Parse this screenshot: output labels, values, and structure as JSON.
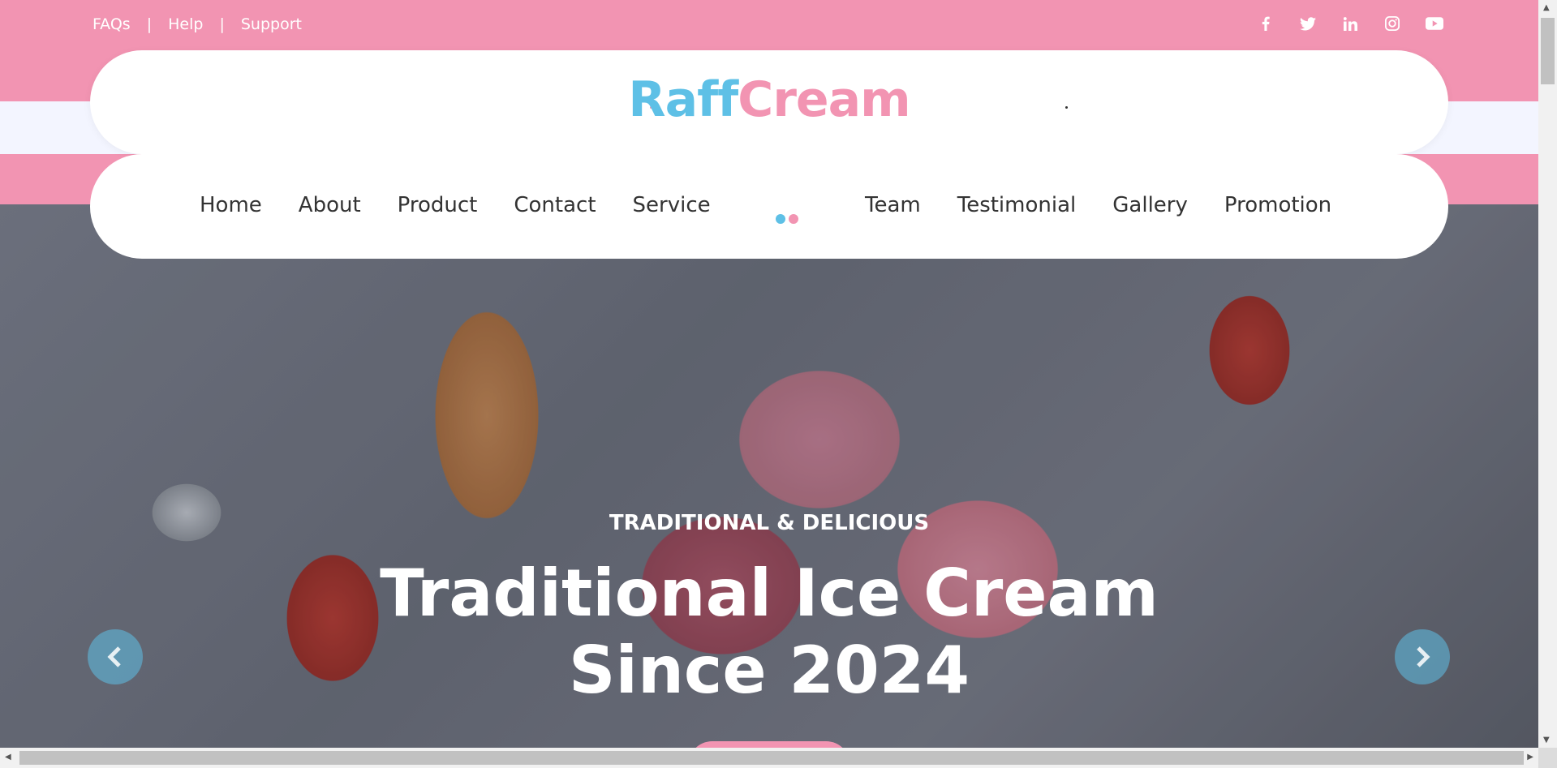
{
  "topbar": {
    "links": [
      "FAQs",
      "Help",
      "Support"
    ],
    "separator": "|"
  },
  "social": {
    "icons": [
      "facebook-icon",
      "twitter-icon",
      "linkedin-icon",
      "instagram-icon",
      "youtube-icon"
    ]
  },
  "brand": {
    "part1": "Raff",
    "part2": "Cream",
    "color1": "#5ec0e6",
    "color2": "#f294b2"
  },
  "nav": {
    "left": [
      "Home",
      "About",
      "Product",
      "Contact",
      "Service"
    ],
    "right": [
      "Team",
      "Testimonial",
      "Gallery",
      "Promotion"
    ]
  },
  "hero": {
    "kicker": "TRADITIONAL & DELICIOUS",
    "title": "Traditional Ice Cream Since 2024"
  },
  "colors": {
    "pink": "#f294b2",
    "light": "#f3f5ff",
    "accent_blue": "#5ec0e6"
  }
}
